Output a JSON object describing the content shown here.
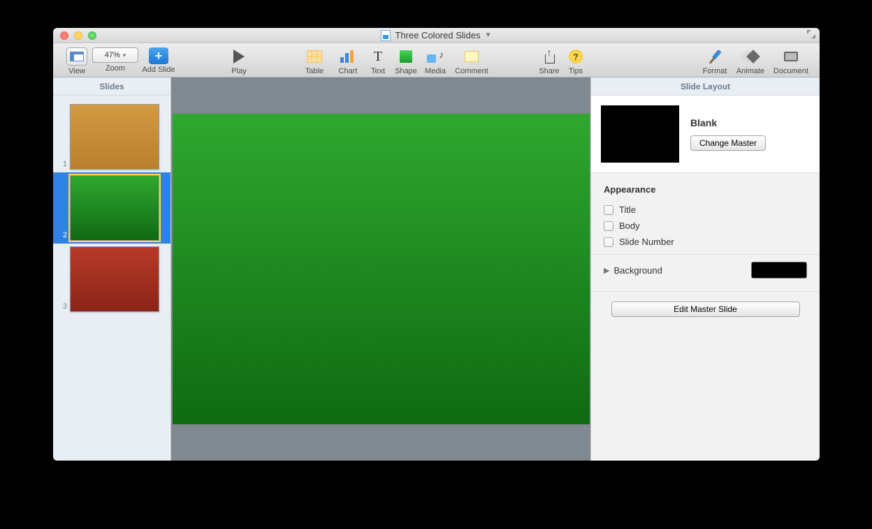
{
  "window": {
    "title": "Three Colored Slides"
  },
  "toolbar": {
    "view": "View",
    "zoom": "Zoom",
    "zoom_value": "47%",
    "add_slide": "Add Slide",
    "play": "Play",
    "table": "Table",
    "chart": "Chart",
    "text": "Text",
    "shape": "Shape",
    "media": "Media",
    "comment": "Comment",
    "share": "Share",
    "tips": "Tips",
    "format": "Format",
    "animate": "Animate",
    "document": "Document"
  },
  "sidebar": {
    "header": "Slides",
    "slides": [
      {
        "num": "1",
        "color_top": "#d39a42",
        "color_bottom": "#b87f2e",
        "selected": false
      },
      {
        "num": "2",
        "color_top": "#2fa82f",
        "color_bottom": "#0f6a12",
        "selected": true
      },
      {
        "num": "3",
        "color_top": "#b83a28",
        "color_bottom": "#8a2418",
        "selected": false
      }
    ]
  },
  "canvas": {
    "color_top": "#2fa82f",
    "color_bottom": "#0f6a12"
  },
  "inspector": {
    "header": "Slide Layout",
    "master_name": "Blank",
    "change_master": "Change Master",
    "appearance_header": "Appearance",
    "title": "Title",
    "body": "Body",
    "slide_number": "Slide Number",
    "background": "Background",
    "background_color": "#000000",
    "edit_master": "Edit Master Slide"
  }
}
